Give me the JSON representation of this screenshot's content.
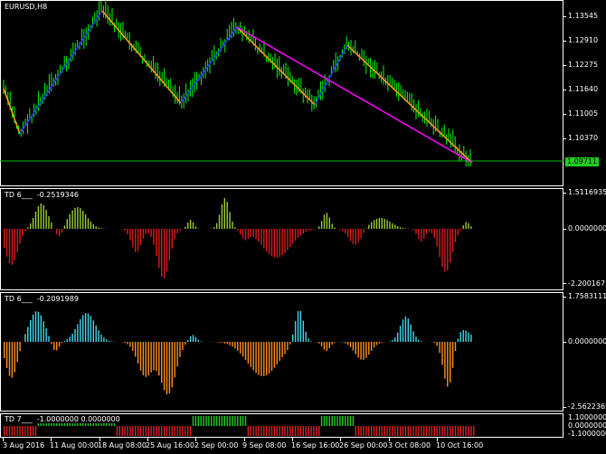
{
  "main_panel": {
    "title": "EURUSD,H8",
    "price_labels": [
      "1.13545",
      "1.12910",
      "1.12275",
      "1.11640",
      "1.11005",
      "1.10370"
    ],
    "current_price": "1.09711",
    "colors": {
      "candle": "#00ff00",
      "zigzag_up": "#1e3cff",
      "zigzag_down": "#ff9e1a",
      "trend": "#ff00ff",
      "bid_line": "#00c000"
    }
  },
  "td6_panel_1": {
    "title": "TD 6___  -0.2519346",
    "labels": [
      "1.5116935",
      "0.0000000",
      "-2.2001671"
    ],
    "colors": {
      "positive": "#9acd32",
      "negative": "#d81c1c"
    }
  },
  "td6_panel_2": {
    "title": "TD 6___  -0.2091989",
    "labels": [
      "1.7583111",
      "0.0000000",
      "-2.5622365"
    ],
    "colors": {
      "positive": "#40d8e8",
      "negative": "#ff9020"
    }
  },
  "td7_panel": {
    "title": "TD 7___  -1.0000000 0.0000000",
    "labels": [
      "1.1000000",
      "0.0000000",
      "-1.1000000"
    ],
    "colors": {
      "positive": "#22cc22",
      "negative": "#dd2222"
    }
  },
  "time_axis": [
    "3 Aug 2016",
    "11 Aug 00:00",
    "18 Aug 08:00",
    "25 Aug 16:00",
    "2 Sep 00:00",
    "9 Sep 08:00",
    "16 Sep 16:00",
    "26 Sep 00:00",
    "3 Oct 08:00",
    "10 Oct 16:00"
  ]
}
